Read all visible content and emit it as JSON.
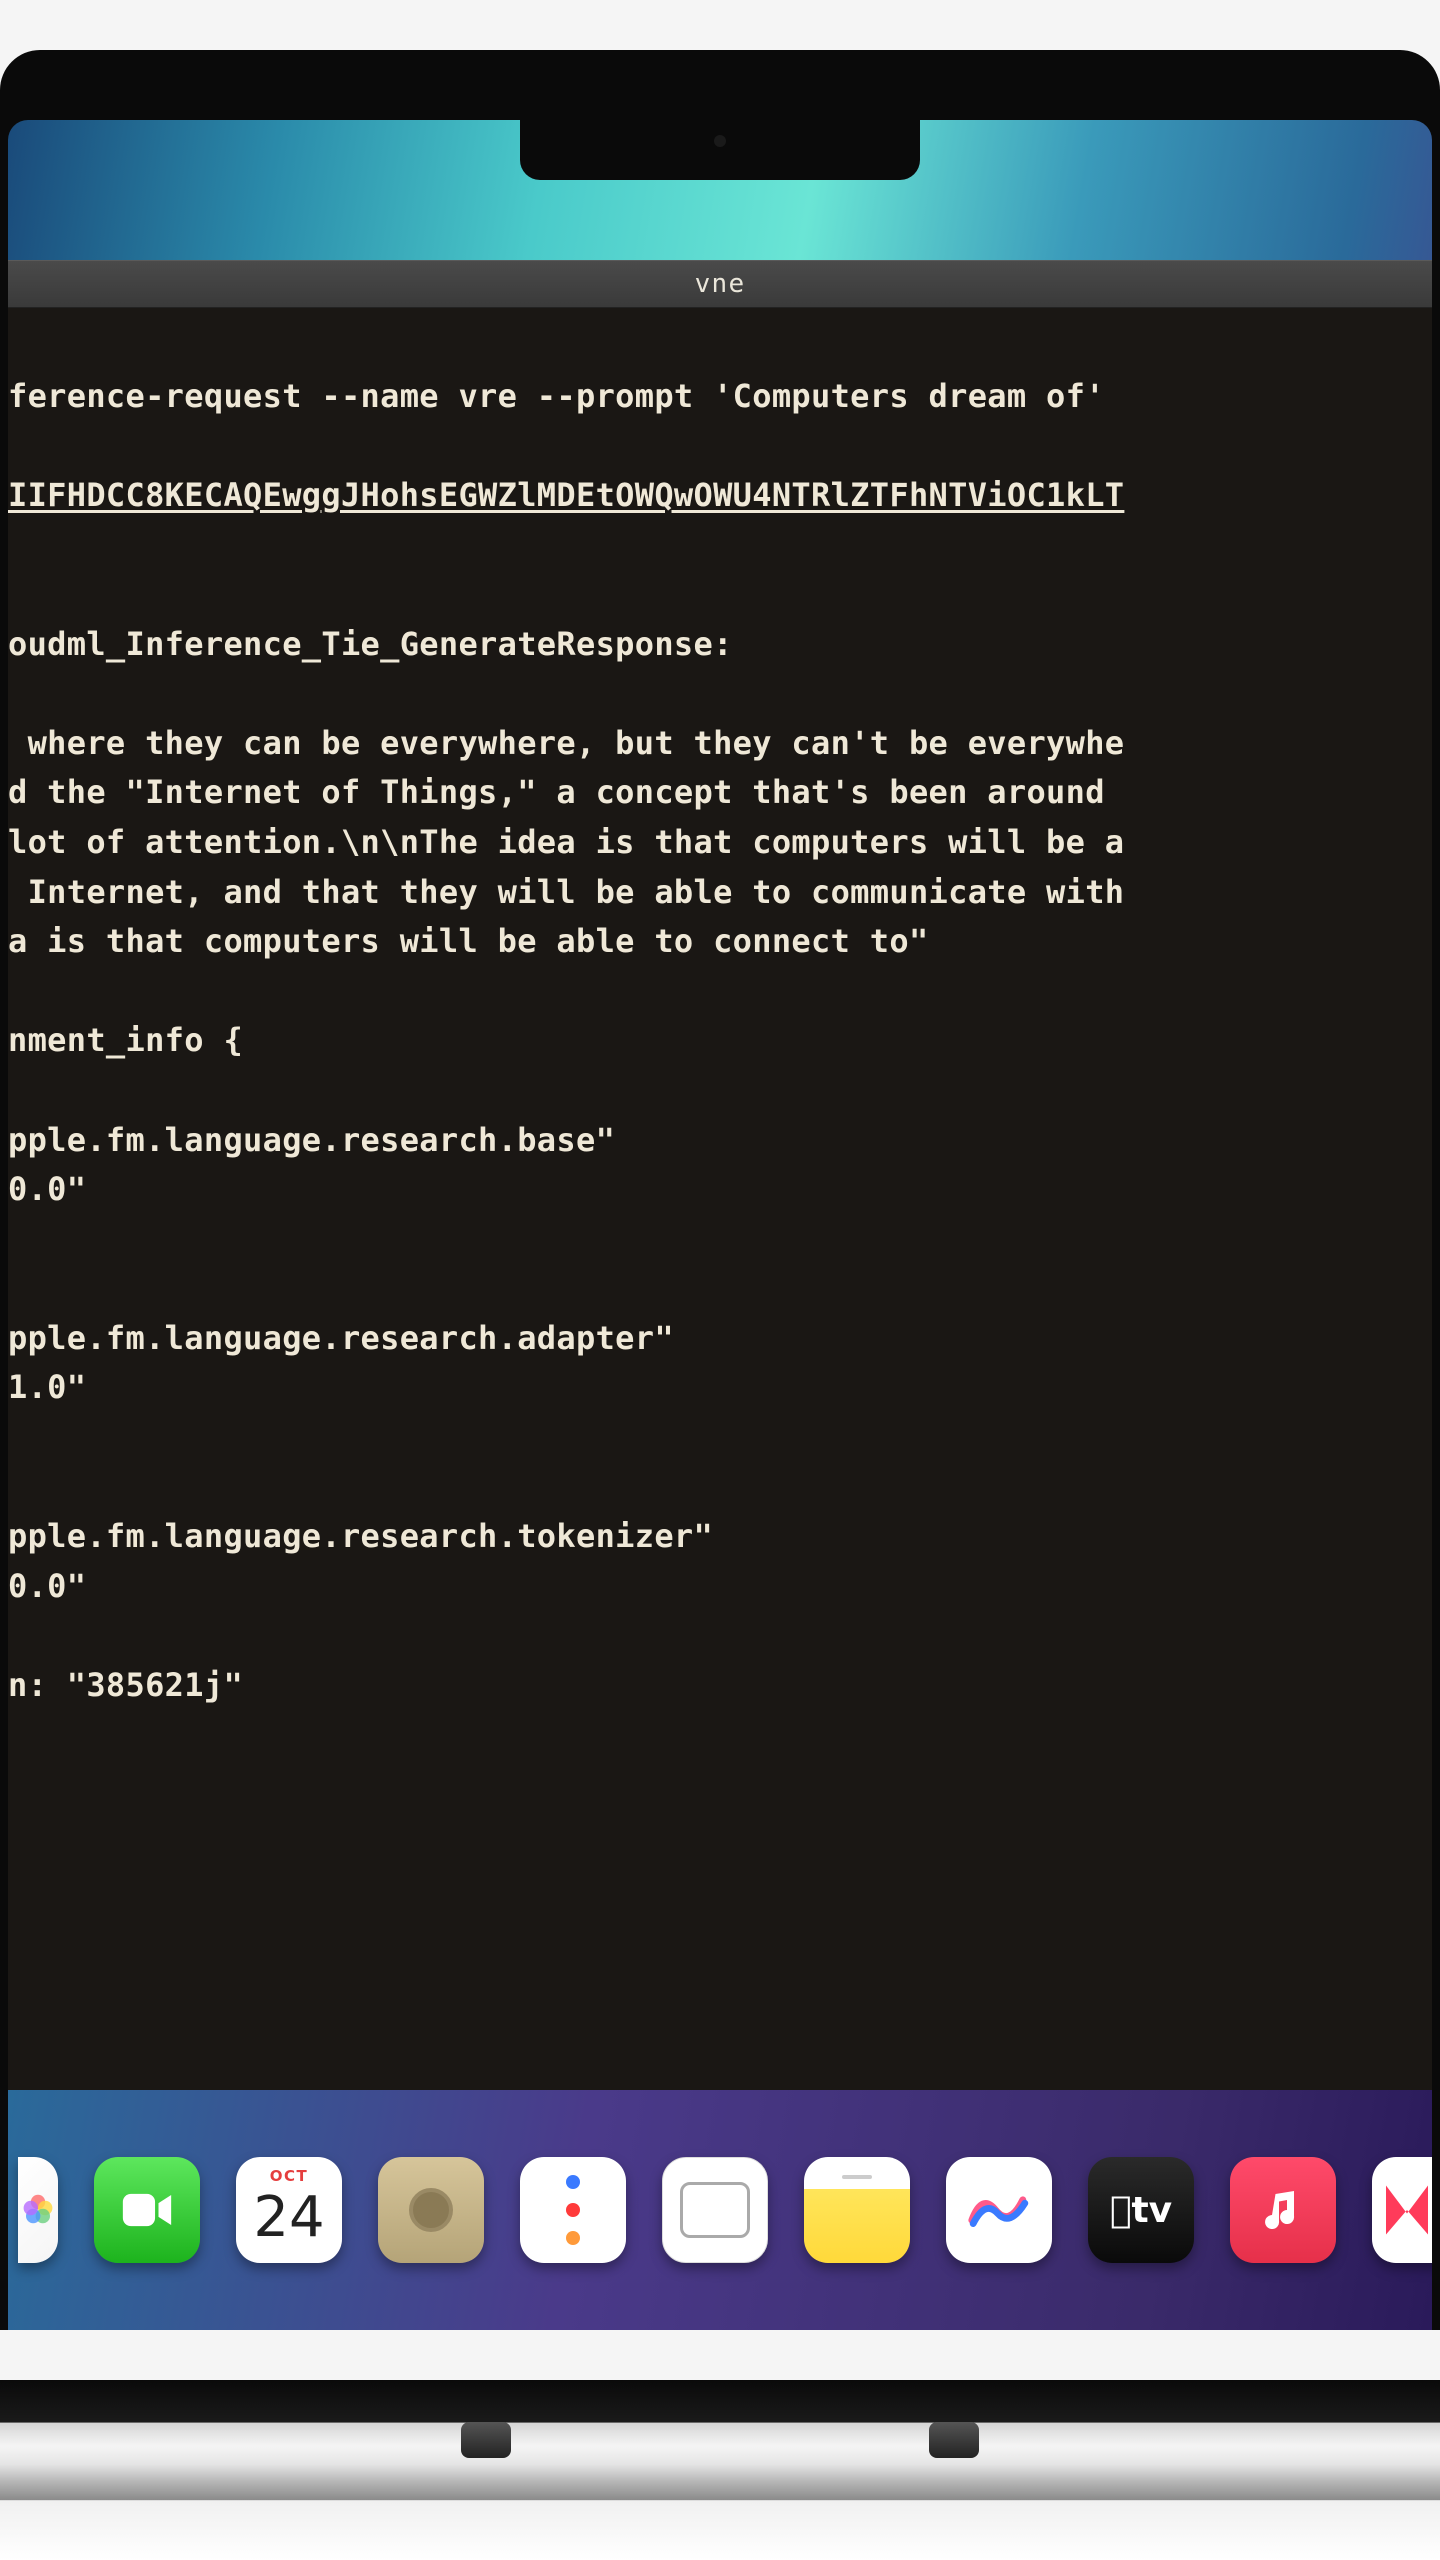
{
  "window": {
    "title": "vne"
  },
  "terminal": {
    "command_line": "ference-request --name vre --prompt 'Computers dream of'",
    "encoded_line": "IIFHDCC8KECAQEwggJHohsEGWZlMDEtOWQwOWU4NTRlZTFhNTViOC1kLT",
    "response_header": "oudml_Inference_Tie_GenerateResponse:",
    "body_lines": [
      " where they can be everywhere, but they can't be everywhe",
      "d the \"Internet of Things,\" a concept that's been around ",
      "lot of attention.\\n\\nThe idea is that computers will be a",
      " Internet, and that they will be able to communicate with",
      "a is that computers will be able to connect to\""
    ],
    "env_header": "nment_info {",
    "model_base_id": "pple.fm.language.research.base\"",
    "model_base_version": "0.0\"",
    "model_adapter_id": "pple.fm.language.research.adapter\"",
    "model_adapter_version": "1.0\"",
    "model_tokenizer_id": "pple.fm.language.research.tokenizer\"",
    "model_tokenizer_version": "0.0\"",
    "run_line": "n: \"385621j\""
  },
  "dock": {
    "calendar_month": "OCT",
    "calendar_day": "24",
    "apps": [
      {
        "name": "photos",
        "label": "Photos"
      },
      {
        "name": "facetime",
        "label": "FaceTime"
      },
      {
        "name": "calendar",
        "label": "Calendar"
      },
      {
        "name": "camera",
        "label": "Camera"
      },
      {
        "name": "reminders",
        "label": "Reminders"
      },
      {
        "name": "files",
        "label": "Files"
      },
      {
        "name": "notes",
        "label": "Notes"
      },
      {
        "name": "freeform",
        "label": "Freeform"
      },
      {
        "name": "tv",
        "label": "TV"
      },
      {
        "name": "music",
        "label": "Music"
      },
      {
        "name": "news",
        "label": "News"
      }
    ]
  }
}
